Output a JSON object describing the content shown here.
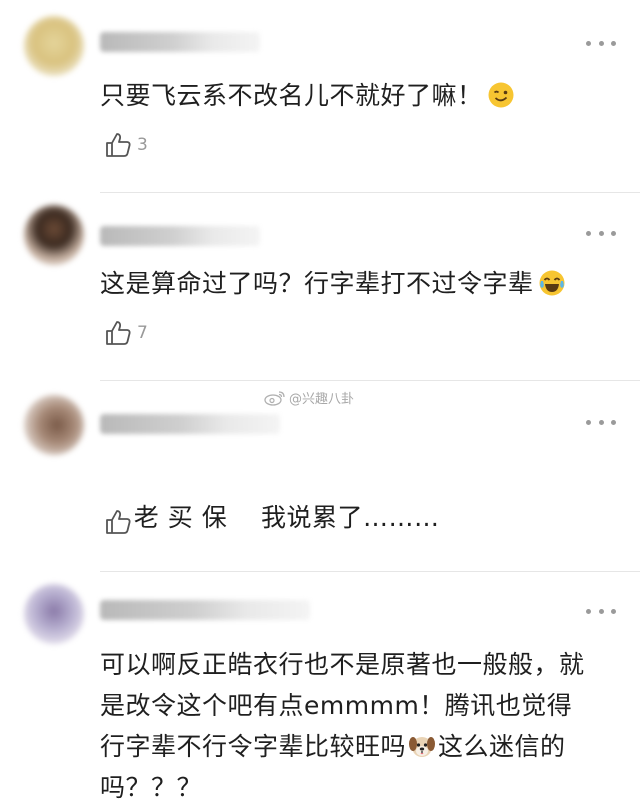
{
  "watermark": {
    "text": "@兴趣八卦"
  },
  "comments": [
    {
      "text": "只要飞云系不改名儿不就好了嘛！",
      "emoji": "wink-emoji",
      "likes": "3"
    },
    {
      "text": "这是算命过了吗？行字辈打不过令字辈",
      "emoji": "tears-of-joy-emoji",
      "likes": "7"
    },
    {
      "text": "老 买 保    我说累了………",
      "emoji": "",
      "likes": ""
    },
    {
      "text_lines": [
        "可以啊反正皓衣行也不是原著也一般般，就",
        "是改令这个吧有点emmmm！腾讯也觉得",
        "行字辈不行令字辈比较旺吗",
        "这么迷信的",
        "吗？？？"
      ],
      "emoji": "dog-face-emoji",
      "likes": ""
    }
  ],
  "colors": {
    "text": "#1f1f1f",
    "meta": "#999999",
    "divider": "#e6e6e6",
    "emoji_yellow": "#f7c531"
  }
}
